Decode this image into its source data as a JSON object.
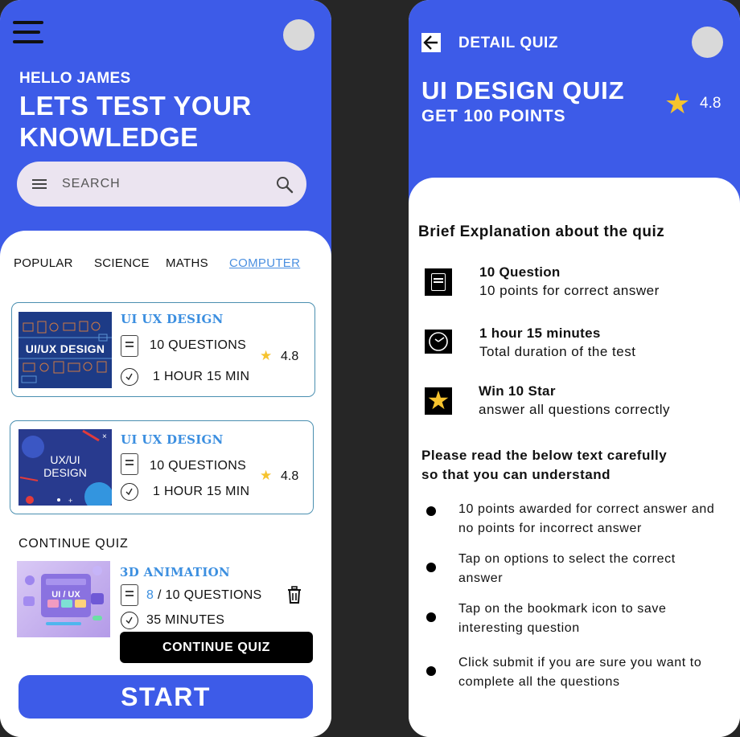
{
  "home": {
    "greeting": "HELLO JAMES",
    "headline_line1": "LETS TEST YOUR",
    "headline_line2": "KNOWLEDGE",
    "search": {
      "placeholder": "SEARCH"
    },
    "tabs": [
      {
        "label": "POPULAR",
        "active": false
      },
      {
        "label": "SCIENCE",
        "active": false
      },
      {
        "label": "MATHS",
        "active": false
      },
      {
        "label": "COMPUTER",
        "active": true
      }
    ],
    "quizzes": [
      {
        "title": "UI UX DESIGN",
        "thumb_text": "UI/UX DESIGN",
        "questions": "10 QUESTIONS",
        "duration": "1 HOUR 15 MIN",
        "rating": "4.8"
      },
      {
        "title": "UI UX DESIGN",
        "thumb_text_line1": "UX/UI",
        "thumb_text_line2": "DESIGN",
        "questions": "10 QUESTIONS",
        "duration": "1 HOUR 15 MIN",
        "rating": "4.8"
      }
    ],
    "continue_section": {
      "label": "CONTINUE QUIZ",
      "quiz": {
        "title": "3D ANIMATION",
        "thumb_text": "UI / UX",
        "progress_done": "8",
        "progress_rest": "/ 10 QUESTIONS",
        "duration": "35 MINUTES",
        "button_label": "CONTINUE QUIZ"
      }
    },
    "start_label": "START",
    "colors": {
      "primary": "#3d5be8",
      "accent_text": "#3c8fe0",
      "star": "#f6c32e"
    }
  },
  "detail": {
    "header_title": "DETAIL QUIZ",
    "quiz_title": "UI DESIGN QUIZ",
    "quiz_subtitle": "GET 100 POINTS",
    "rating": "4.8",
    "brief_heading": "Brief Explanation about the quiz",
    "features": [
      {
        "icon": "document-icon",
        "title": "10 Question",
        "desc": "10 points for correct answer"
      },
      {
        "icon": "clock-icon",
        "title": "1 hour 15 minutes",
        "desc": "Total duration of the test"
      },
      {
        "icon": "star-icon",
        "title": "Win 10 Star",
        "desc": "answer all questions correctly"
      }
    ],
    "read_heading_line1": "Please read the below text carefully",
    "read_heading_line2": "so that you can understand",
    "rules": [
      {
        "line1": "10 points awarded for correct answer and",
        "line2": "no points for incorrect answer"
      },
      {
        "line1": "Tap on options to select the correct",
        "line2": "answer"
      },
      {
        "line1": "Tap on the bookmark icon to save",
        "line2": "interesting question"
      },
      {
        "line1": "Click submit if you are sure you want to",
        "line2": "complete all the questions"
      }
    ]
  }
}
